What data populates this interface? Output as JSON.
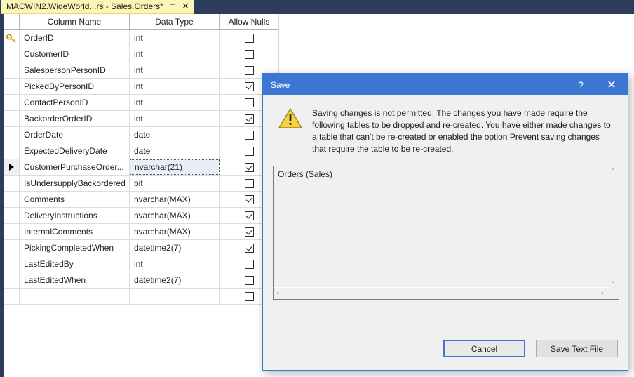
{
  "tab": {
    "title": "MACWIN2.WideWorld...rs - Sales.Orders*",
    "pin_icon": "pin-icon",
    "close_icon": "✕",
    "pin_glyph": "⊐"
  },
  "grid": {
    "headers": [
      "",
      "Column Name",
      "Data Type",
      "Allow Nulls"
    ],
    "rows": [
      {
        "gutter": "key",
        "name": "OrderID",
        "type": "int",
        "allow_nulls": false
      },
      {
        "gutter": "",
        "name": "CustomerID",
        "type": "int",
        "allow_nulls": false
      },
      {
        "gutter": "",
        "name": "SalespersonPersonID",
        "type": "int",
        "allow_nulls": false
      },
      {
        "gutter": "",
        "name": "PickedByPersonID",
        "type": "int",
        "allow_nulls": true
      },
      {
        "gutter": "",
        "name": "ContactPersonID",
        "type": "int",
        "allow_nulls": false
      },
      {
        "gutter": "",
        "name": "BackorderOrderID",
        "type": "int",
        "allow_nulls": true
      },
      {
        "gutter": "",
        "name": "OrderDate",
        "type": "date",
        "allow_nulls": false
      },
      {
        "gutter": "",
        "name": "ExpectedDeliveryDate",
        "type": "date",
        "allow_nulls": false
      },
      {
        "gutter": "arrow",
        "name": "CustomerPurchaseOrder...",
        "type": "nvarchar(21)",
        "allow_nulls": true,
        "selected": true
      },
      {
        "gutter": "",
        "name": "IsUndersupplyBackordered",
        "type": "bit",
        "allow_nulls": false
      },
      {
        "gutter": "",
        "name": "Comments",
        "type": "nvarchar(MAX)",
        "allow_nulls": true
      },
      {
        "gutter": "",
        "name": "DeliveryInstructions",
        "type": "nvarchar(MAX)",
        "allow_nulls": true
      },
      {
        "gutter": "",
        "name": "InternalComments",
        "type": "nvarchar(MAX)",
        "allow_nulls": true
      },
      {
        "gutter": "",
        "name": "PickingCompletedWhen",
        "type": "datetime2(7)",
        "allow_nulls": true
      },
      {
        "gutter": "",
        "name": "LastEditedBy",
        "type": "int",
        "allow_nulls": false
      },
      {
        "gutter": "",
        "name": "LastEditedWhen",
        "type": "datetime2(7)",
        "allow_nulls": false
      },
      {
        "gutter": "",
        "name": "",
        "type": "",
        "allow_nulls": false
      }
    ]
  },
  "dialog": {
    "title": "Save",
    "help_glyph": "?",
    "close_glyph": "✕",
    "warning_icon": "warning-triangle-icon",
    "message": "Saving changes is not permitted. The changes you have made require the following tables to be dropped and re-created. You have either made changes to a table that can't be re-created or enabled the option Prevent saving changes that require the table to be re-created.",
    "listbox": {
      "items": [
        "Orders (Sales)"
      ],
      "scroll_up_glyph": "⌃",
      "scroll_down_glyph": "⌄",
      "scroll_left_glyph": "‹",
      "scroll_right_glyph": "›"
    },
    "buttons": {
      "cancel": "Cancel",
      "save_text_file": "Save Text File"
    }
  },
  "colors": {
    "topbar": "#2d3c5c",
    "tab_background": "#fcf5b6",
    "dialog_title": "#3a76d2",
    "focus_border": "#3a76d2"
  }
}
